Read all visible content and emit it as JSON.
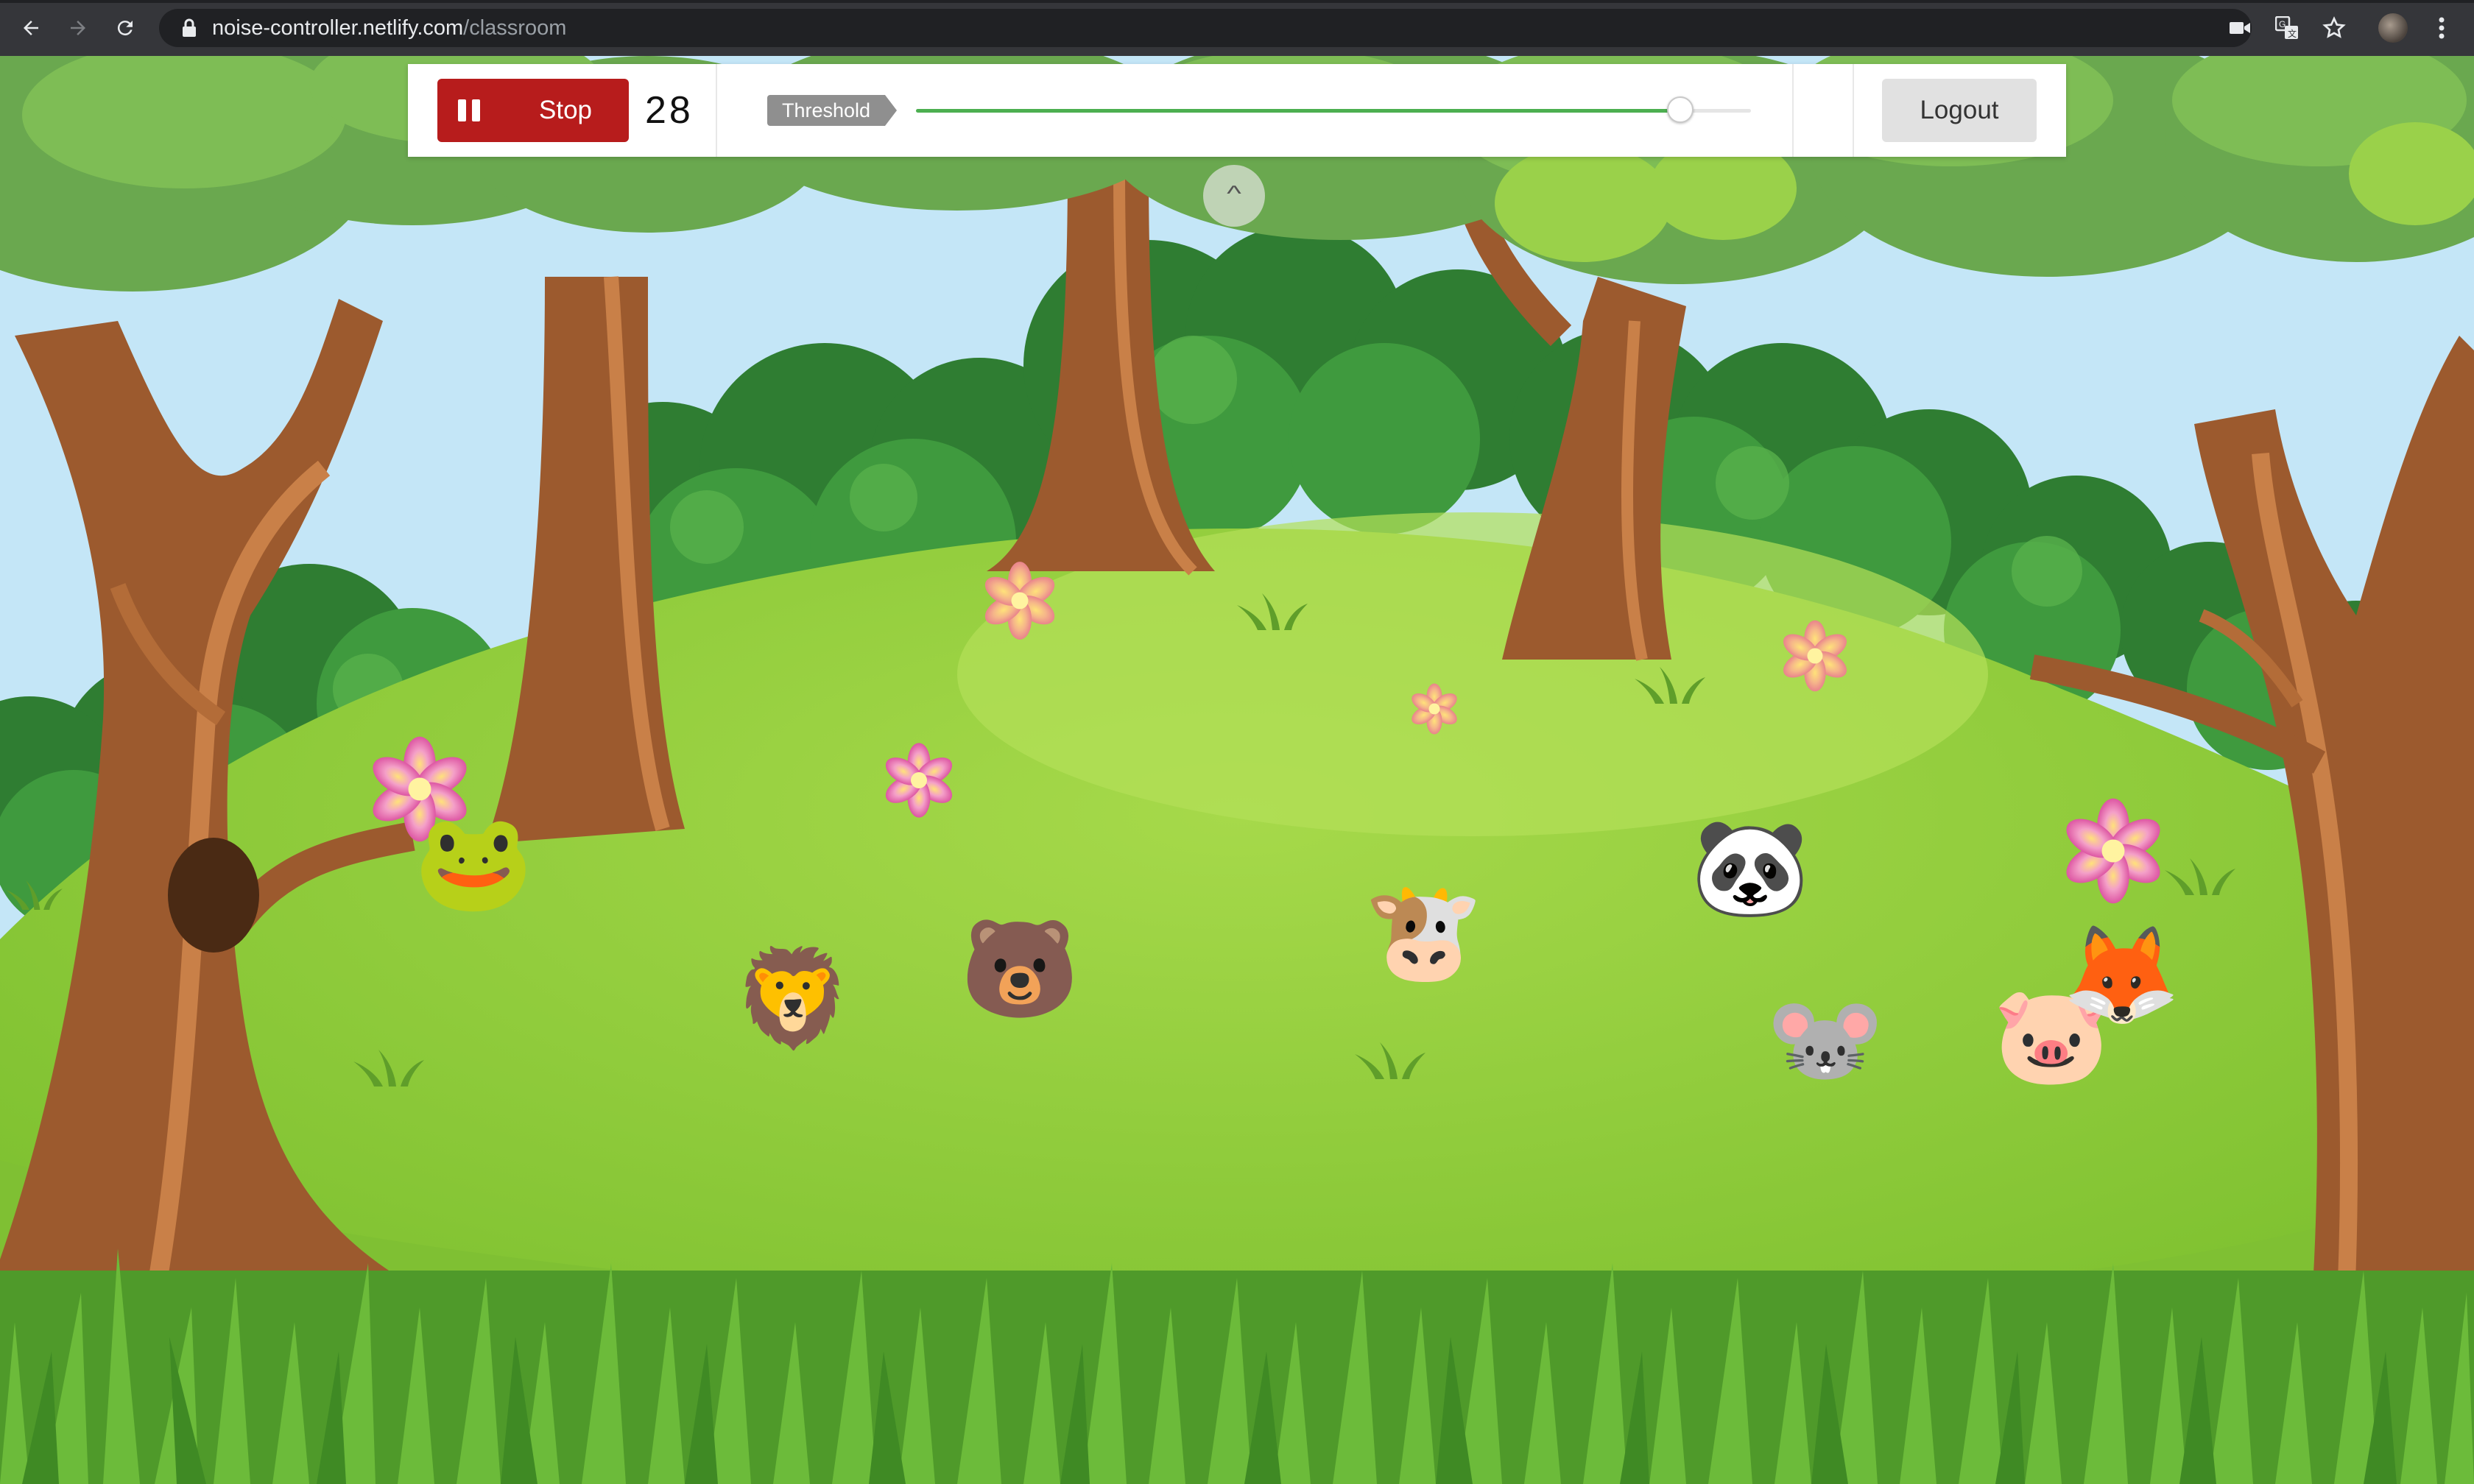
{
  "browser": {
    "url_host": "noise-controller.netlify.com",
    "url_path": "/classroom",
    "icons": {
      "back": "arrow-left-icon",
      "forward": "arrow-right-icon",
      "reload": "reload-icon",
      "lock": "lock-icon",
      "camera": "camera-icon",
      "translate": "translate-icon",
      "bookmark": "star-icon",
      "menu": "kebab-menu-icon"
    }
  },
  "toolbar": {
    "stop_label": "Stop",
    "noise_level": "28",
    "threshold_label": "Threshold",
    "threshold_fraction": 0.915,
    "logout_label": "Logout",
    "colors": {
      "stop": "#b71c1c",
      "slider_fill": "#4caf50",
      "threshold_tag": "#8f8f8f",
      "logout": "#e1e1e1"
    }
  },
  "scene": {
    "animals": [
      {
        "name": "frog",
        "emoji": "🐸"
      },
      {
        "name": "lion",
        "emoji": "🦁"
      },
      {
        "name": "bear",
        "emoji": "🐻"
      },
      {
        "name": "cow",
        "emoji": "🐮"
      },
      {
        "name": "panda",
        "emoji": "🐼"
      },
      {
        "name": "mouse",
        "emoji": "🐭"
      },
      {
        "name": "pig",
        "emoji": "🐷"
      },
      {
        "name": "fox",
        "emoji": "🦊"
      }
    ]
  }
}
